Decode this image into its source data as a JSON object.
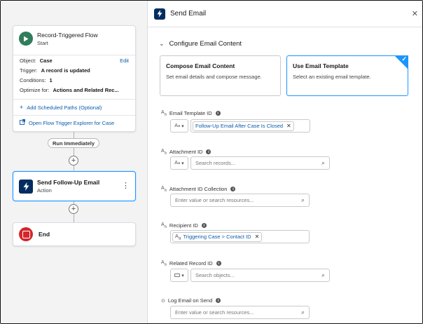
{
  "canvas": {
    "start": {
      "title": "Record-Triggered Flow",
      "subtitle": "Start",
      "object_key": "Object:",
      "object_value": "Case",
      "edit_label": "Edit",
      "trigger_key": "Trigger:",
      "trigger_value": "A record is updated",
      "conditions_key": "Conditions:",
      "conditions_value": "1",
      "optimize_key": "Optimize for:",
      "optimize_value": "Actions and Related Rec...",
      "add_paths_label": "Add Scheduled Paths (Optional)",
      "open_explorer_label": "Open Flow Trigger Explorer for Case"
    },
    "run_immediately_label": "Run Immediately",
    "action": {
      "title": "Send Follow-Up Email",
      "subtitle": "Action"
    },
    "end": {
      "title": "End"
    }
  },
  "panel": {
    "title": "Send Email",
    "section_title": "Configure Email Content",
    "tiles": [
      {
        "title": "Compose Email Content",
        "description": "Set email details and compose message.",
        "selected": false
      },
      {
        "title": "Use Email Template",
        "description": "Select an existing email template.",
        "selected": true
      }
    ],
    "fields": {
      "email_template_id": {
        "label": "Email Template ID",
        "value": "Follow-Up Email After Case Is Closed"
      },
      "attachment_id": {
        "label": "Attachment ID",
        "placeholder": "Search records..."
      },
      "attachment_id_collection": {
        "label": "Attachment ID Collection",
        "placeholder": "Enter value or search resources..."
      },
      "recipient_id": {
        "label": "Recipient ID",
        "value": "Triggering Case > Contact ID"
      },
      "related_record_id": {
        "label": "Related Record ID",
        "placeholder": "Search objects..."
      },
      "log_email_on_send": {
        "label": "Log Email on Send",
        "placeholder": "Enter value or search resources..."
      }
    }
  },
  "colors": {
    "accent": "#1b96ff",
    "link": "#0b5cab",
    "start_icon": "#2e7d5b",
    "action_icon": "#032d60",
    "end_icon": "#d3272b"
  },
  "icons": {
    "start": "play-icon",
    "action": "lightning-icon",
    "end": "stop-icon",
    "close": "close-icon",
    "search": "search-icon",
    "info": "info-icon"
  }
}
